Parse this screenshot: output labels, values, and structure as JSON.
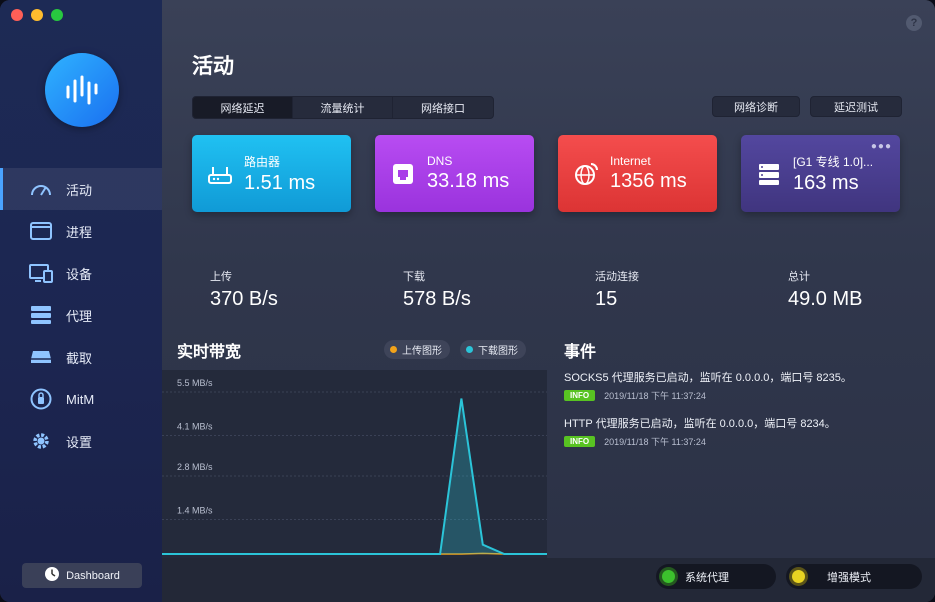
{
  "sidebar": {
    "items": [
      {
        "label": "活动",
        "icon": "gauge-icon",
        "active": true
      },
      {
        "label": "进程",
        "icon": "window-icon",
        "active": false
      },
      {
        "label": "设备",
        "icon": "monitor-icon",
        "active": false
      },
      {
        "label": "代理",
        "icon": "server-icon",
        "active": false
      },
      {
        "label": "截取",
        "icon": "disk-icon",
        "active": false
      },
      {
        "label": "MitM",
        "icon": "lock-icon",
        "active": false
      },
      {
        "label": "设置",
        "icon": "gear-icon",
        "active": false
      }
    ],
    "dashboard_label": "Dashboard"
  },
  "header": {
    "title": "活动",
    "tabs": [
      {
        "label": "网络延迟",
        "active": true
      },
      {
        "label": "流量统计",
        "active": false
      },
      {
        "label": "网络接口",
        "active": false
      }
    ],
    "diag_label": "网络诊断",
    "test_label": "延迟测试"
  },
  "cards": [
    {
      "label": "路由器",
      "value": "1.51 ms",
      "icon": "router-icon",
      "color": "#1ab0e6"
    },
    {
      "label": "DNS",
      "value": "33.18 ms",
      "icon": "dns-icon",
      "color": "#a93ee8"
    },
    {
      "label": "Internet",
      "value": "1356 ms",
      "icon": "globe-icon",
      "color": "#ea4040"
    },
    {
      "label": "[G1 专线 1.0]...",
      "value": "163 ms",
      "icon": "server-icon",
      "color": "#4a3e93"
    }
  ],
  "stats": [
    {
      "label": "上传",
      "value": "370 B/s"
    },
    {
      "label": "下载",
      "value": "578 B/s"
    },
    {
      "label": "活动连接",
      "value": "15"
    },
    {
      "label": "总计",
      "value": "49.0 MB"
    }
  ],
  "bandwidth": {
    "title": "实时带宽",
    "legend_upload": "上传图形",
    "legend_download": "下载图形",
    "upload_color": "#f2a31a",
    "download_color": "#2bc4d8"
  },
  "chart_data": {
    "type": "area",
    "ylabels": [
      "5.5 MB/s",
      "4.1 MB/s",
      "2.8 MB/s",
      "1.4 MB/s"
    ],
    "ylim": [
      0,
      5.5
    ],
    "grid": true,
    "series": [
      {
        "name": "上传图形",
        "values": [
          0,
          0,
          0,
          0,
          0,
          0,
          0,
          0,
          0,
          0,
          0,
          0,
          0,
          0,
          0,
          0.02,
          0,
          0,
          0
        ]
      },
      {
        "name": "下载图形",
        "values": [
          0,
          0,
          0,
          0,
          0,
          0,
          0,
          0,
          0,
          0,
          0,
          0,
          0,
          0,
          5.0,
          0.3,
          0,
          0,
          0
        ]
      }
    ]
  },
  "events": {
    "title": "事件",
    "items": [
      {
        "text": "SOCKS5 代理服务已启动，监听在 0.0.0.0，端口号 8235。",
        "level": "INFO",
        "time": "2019/11/18 下午 11:37:24"
      },
      {
        "text": "HTTP 代理服务已启动，监听在 0.0.0.0，端口号 8234。",
        "level": "INFO",
        "time": "2019/11/18 下午 11:37:24"
      }
    ]
  },
  "footer": {
    "system_proxy_label": "系统代理",
    "system_proxy_color": "#3cc12d",
    "enhanced_mode_label": "增强模式",
    "enhanced_mode_color": "#e8d322"
  }
}
